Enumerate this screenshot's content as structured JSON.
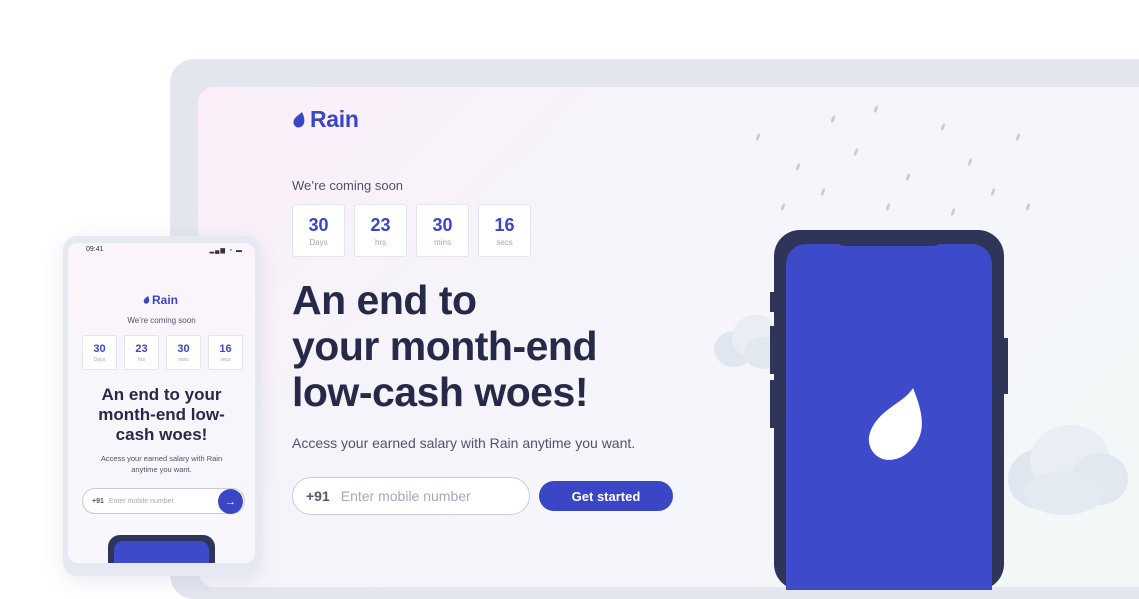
{
  "brand": {
    "name": "Rain",
    "accent": "#3b46c7",
    "dark": "#262a48"
  },
  "desktop": {
    "coming_soon": "We’re coming soon",
    "countdown": [
      {
        "value": "30",
        "unit": "Days"
      },
      {
        "value": "23",
        "unit": "hrs"
      },
      {
        "value": "30",
        "unit": "mins"
      },
      {
        "value": "16",
        "unit": "secs"
      }
    ],
    "headline": [
      "An end to",
      "your month-end",
      "low-cash woes!"
    ],
    "subtext": "Access your earned salary with Rain anytime you want.",
    "input": {
      "country_code": "+91",
      "placeholder": "Enter mobile number"
    },
    "cta_label": "Get started"
  },
  "mobile": {
    "status_time": "09:41",
    "status_icons": "signal-wifi-battery-icons",
    "coming_soon": "We’re coming soon",
    "countdown": [
      {
        "value": "30",
        "unit": "Days"
      },
      {
        "value": "23",
        "unit": "hrs"
      },
      {
        "value": "30",
        "unit": "mins"
      },
      {
        "value": "16",
        "unit": "secs"
      }
    ],
    "headline": [
      "An end to your",
      "month-end low-",
      "cash woes!"
    ],
    "subtext": [
      "Access your earned salary with Rain",
      "anytime you want."
    ],
    "input": {
      "country_code": "+91",
      "placeholder": "Enter mobile number"
    },
    "go_icon": "arrow-right-icon"
  }
}
